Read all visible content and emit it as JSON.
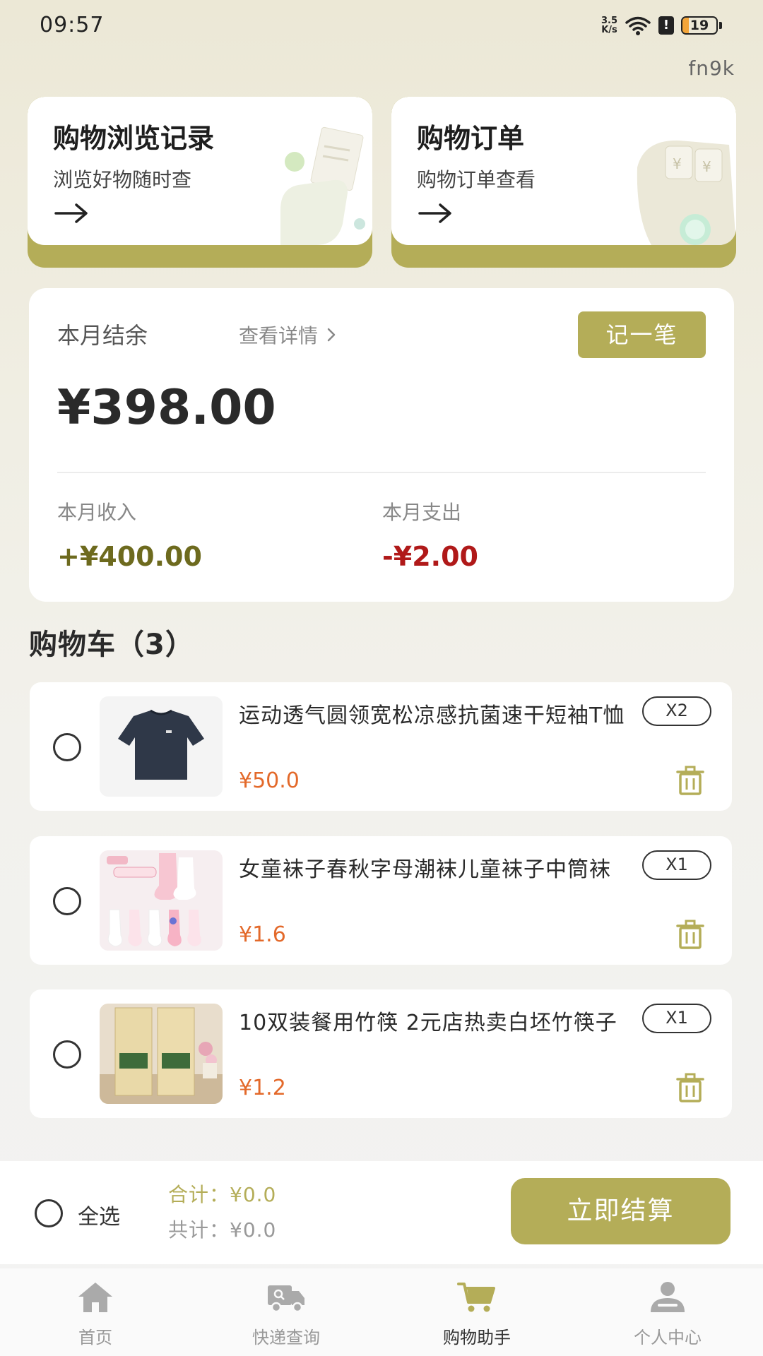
{
  "status_bar": {
    "time": "09:57",
    "net_speed_value": "3.5",
    "net_speed_unit": "K/s",
    "battery": "19",
    "battery_level": 0.19
  },
  "watermark": "fn9k",
  "top_cards": {
    "history": {
      "title": "购物浏览记录",
      "subtitle": "浏览好物随时查",
      "icon": "arrow-right-icon"
    },
    "orders": {
      "title": "购物订单",
      "subtitle": "购物订单查看",
      "icon": "arrow-right-icon"
    }
  },
  "balance": {
    "label": "本月结余",
    "detail_link": "查看详情",
    "record_button": "记一笔",
    "amount": "¥398.00",
    "income_label": "本月收入",
    "income_value": "+¥400.00",
    "expense_label": "本月支出",
    "expense_value": "-¥2.00"
  },
  "cart": {
    "title": "购物车（3）",
    "items": [
      {
        "name": "运动透气圆领宽松凉感抗菌速干短袖T恤",
        "price": "¥50.0",
        "qty": "X2"
      },
      {
        "name": "女童袜子春秋字母潮袜儿童袜子中筒袜",
        "price": "¥1.6",
        "qty": "X1"
      },
      {
        "name": "10双装餐用竹筷 2元店热卖白坯竹筷子",
        "price": "¥1.2",
        "qty": "X1"
      }
    ]
  },
  "checkout": {
    "select_all": "全选",
    "sum": "合计：¥0.0",
    "total": "共计：¥0.0",
    "button": "立即结算"
  },
  "tabs": [
    {
      "label": "首页",
      "icon": "home-icon",
      "active": false
    },
    {
      "label": "快递查询",
      "icon": "truck-icon",
      "active": false
    },
    {
      "label": "购物助手",
      "icon": "cart-icon",
      "active": true
    },
    {
      "label": "个人中心",
      "icon": "user-icon",
      "active": false
    }
  ],
  "colors": {
    "accent": "#b4ad58",
    "income": "#6d6a1e",
    "expense": "#b01919",
    "price": "#e3692a",
    "tab_inactive": "#aaaaaa"
  }
}
